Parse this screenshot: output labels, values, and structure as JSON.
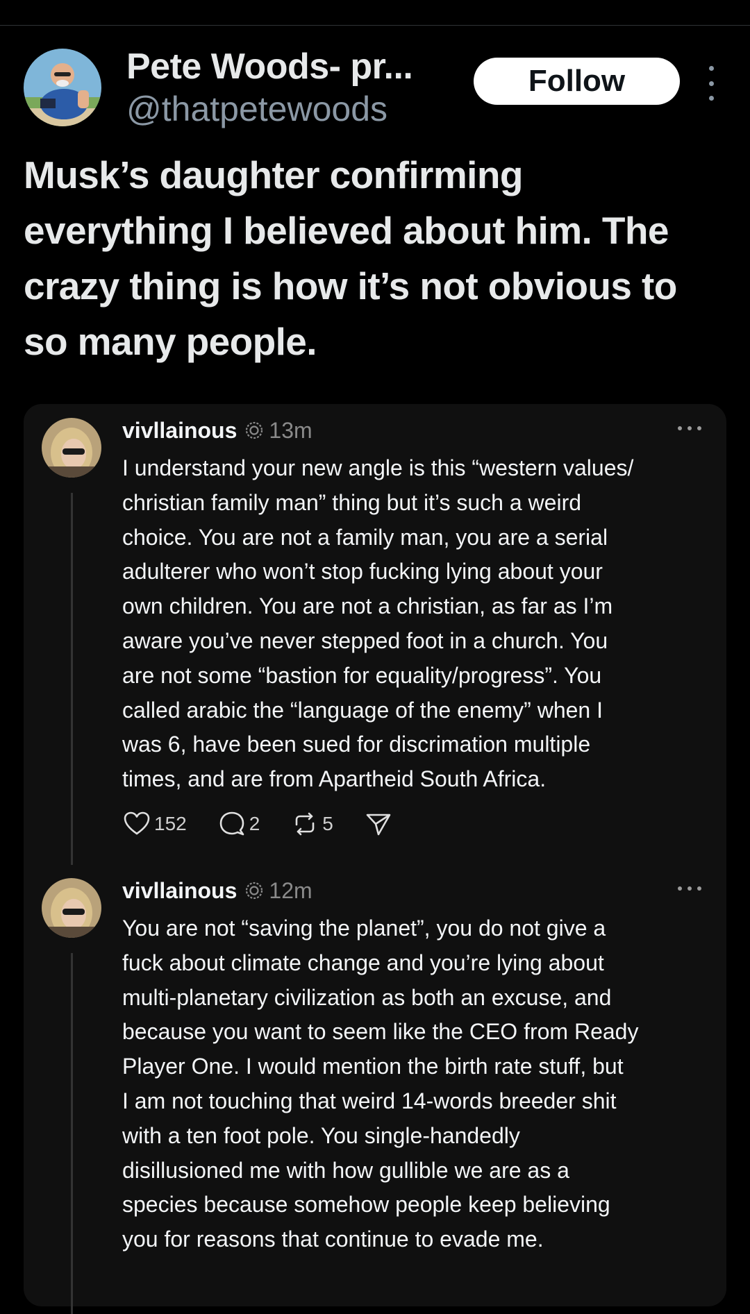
{
  "tweet": {
    "author_name": "Pete Woods- pr...",
    "author_handle": "@thatpetewoods",
    "follow_label": "Follow",
    "text_lines": [
      "Musk’s daughter confirming",
      "everything I believed about him. The",
      "crazy thing is how it’s not obvious to",
      "so many people."
    ]
  },
  "quoted_thread": {
    "posts": [
      {
        "username": "vivllainous",
        "time": "13m",
        "lines": [
          "I understand your new angle is this “western values/",
          "christian family man” thing but it’s such a weird",
          "choice. You are not a family man, you are a serial",
          "adulterer who won’t stop fucking lying about your",
          "own children. You are not a christian, as far as I’m",
          "aware you’ve never stepped foot in a church. You",
          "are not some “bastion for equality/progress”. You",
          "called arabic the “language of the enemy” when I",
          "was 6, have been sued for discrimation multiple",
          "times, and are from Apartheid South Africa."
        ],
        "likes": "152",
        "replies": "2",
        "reposts": "5"
      },
      {
        "username": "vivllainous",
        "time": "12m",
        "lines": [
          "You are not “saving the planet”, you do not give a",
          "fuck about climate change and you’re lying about",
          "multi-planetary civilization as both an excuse, and",
          "because you want to seem like the CEO from Ready",
          "Player One. I would mention the birth rate stuff, but",
          "I am not touching that weird 14-words breeder shit",
          "with a ten foot pole. You single-handedly",
          "disillusioned me with how gullible we are as a",
          "species because somehow people keep believing",
          "you for reasons that continue to evade me."
        ]
      }
    ]
  },
  "icons": {
    "more": "more-vertical-icon",
    "post_more": "more-horizontal-icon",
    "badge": "threads-badge-icon",
    "like": "heart-icon",
    "reply": "comment-icon",
    "repost": "repost-icon",
    "share": "send-icon"
  },
  "colors": {
    "background": "#000000",
    "card": "#101010",
    "text": "#e7e9ea",
    "muted": "#8b98a5",
    "follow_button": "#ffffff"
  }
}
